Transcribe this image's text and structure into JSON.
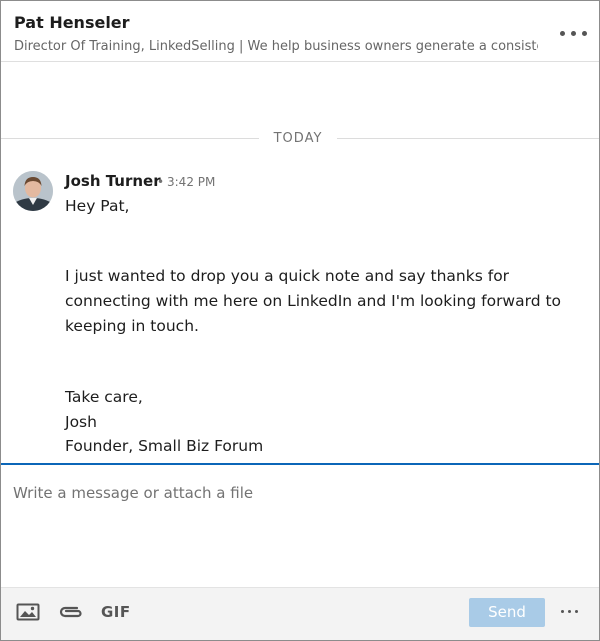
{
  "header": {
    "name": "Pat Henseler",
    "headline": "Director Of Training, LinkedSelling | We help business owners generate a consister",
    "more_icon": "more-horizontal-icon"
  },
  "thread": {
    "date_divider": "TODAY",
    "message": {
      "sender": "Josh Turner",
      "separator": "•",
      "time": "3:42 PM",
      "lines": [
        "Hey Pat,",
        "I just wanted to drop you a quick note and say thanks for",
        "connecting with me here on LinkedIn and I'm looking forward to",
        "keeping in touch.",
        "Take care,",
        "Josh",
        "Founder, Small Biz Forum"
      ]
    }
  },
  "composer": {
    "placeholder": "Write a message or attach a file"
  },
  "footer": {
    "image_icon": "image-icon",
    "attach_icon": "paperclip-icon",
    "gif_label": "GIF",
    "send_label": "Send",
    "more_icon": "more-horizontal-icon"
  },
  "colors": {
    "accent": "#0b66b8",
    "send_disabled": "#a9cbe7"
  }
}
